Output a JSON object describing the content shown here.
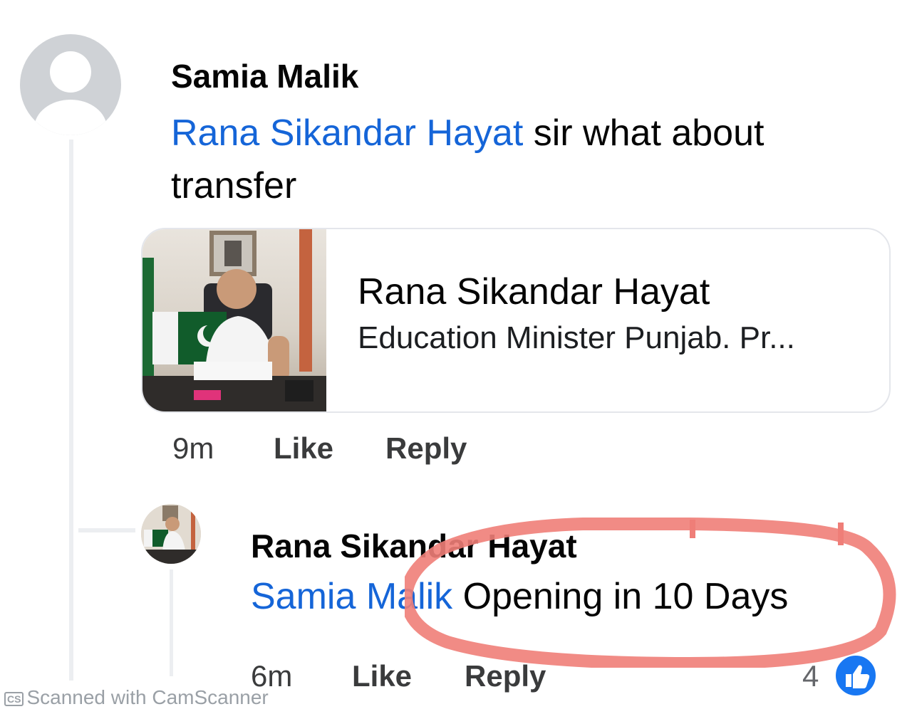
{
  "comment": {
    "author": "Samia Malik",
    "mention": "Rana Sikandar Hayat",
    "text_line1": " sir what about",
    "text_line2": "transfer",
    "link_card": {
      "title": "Rana Sikandar Hayat",
      "subtitle": "Education Minister Punjab. Pr..."
    },
    "time": "9m",
    "like_label": "Like",
    "reply_label": "Reply"
  },
  "reply": {
    "author": "Rana Sikandar Hayat",
    "mention": "Samia Malik",
    "text": " Opening in 10 Days",
    "time": "6m",
    "like_label": "Like",
    "reply_label": "Reply",
    "reaction_count": "4",
    "reaction_icon": "like-reaction-icon"
  },
  "watermark": {
    "logo": "CS",
    "text": "Scanned with CamScanner"
  },
  "colors": {
    "mention": "#1565d8",
    "highlight": "#ef7e78",
    "like_reaction": "#1877f2"
  }
}
